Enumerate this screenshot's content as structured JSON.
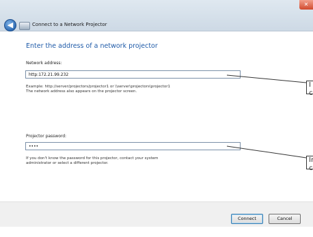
{
  "window": {
    "title": "Connect to a Network Projector",
    "close_glyph": "✕",
    "back_glyph": "◀"
  },
  "main": {
    "heading": "Enter the address of a network projector",
    "address_label": "Network address:",
    "address_value": "http:172.21.99.232",
    "address_hint": "Example: http://server/projectors/projector1 or \\\\server\\projectors\\projector1\nThe network address also appears on the projector screen.",
    "password_label": "Projector password:",
    "password_value": "••••",
    "password_hint": "If you don't know the password for this projector, contact your system\nadministrator or select a different projector."
  },
  "callouts": {
    "first_text": "I c",
    "second_text": "In c"
  },
  "buttons": {
    "connect": "Connect",
    "cancel": "Cancel"
  },
  "colors": {
    "heading": "#1e5aa8",
    "titlebar": "#dfe8f0",
    "close": "#d0492d"
  },
  "icons": {
    "back": "back-arrow-icon",
    "wizard": "projector-icon",
    "close": "close-icon"
  }
}
